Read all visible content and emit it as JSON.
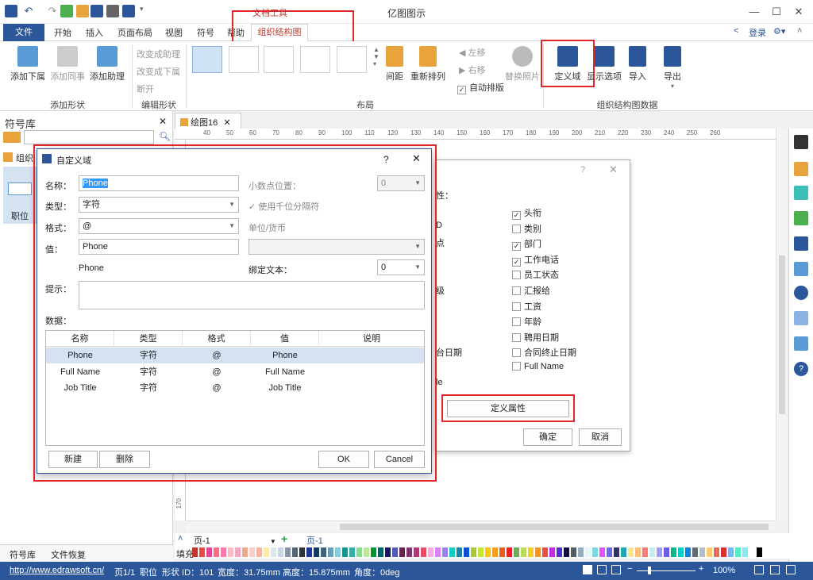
{
  "app": {
    "title": "亿图图示",
    "context_tools_label": "文档工具",
    "login": "登录"
  },
  "tabs": {
    "file": "文件",
    "home": "开始",
    "insert": "插入",
    "page_layout": "页面布局",
    "view": "视图",
    "symbol": "符号",
    "help": "帮助",
    "org_chart": "组织结构图"
  },
  "ribbon": {
    "add_shape": {
      "add_subordinate": "添加下属",
      "add_colleague": "添加同事",
      "add_assistant": "添加助理",
      "group": "添加形状"
    },
    "edit_shape": {
      "to_assistant": "改变成助理",
      "to_subordinate": "改变成下属",
      "break": "断开",
      "group": "编辑形状"
    },
    "layout": {
      "spacing": "间距",
      "rearrange": "重新排列",
      "move_left": "左移",
      "move_right": "右移",
      "auto_arrange": "自动排版",
      "replace_photo": "替换照片",
      "group": "布局"
    },
    "org_data": {
      "define_field": "定义域",
      "display_options": "显示选项",
      "import": "导入",
      "export": "导出",
      "group": "组织结构图数据"
    }
  },
  "left_panel": {
    "title": "符号库",
    "lib_item": "组织",
    "shape_label": "职位",
    "tab_library": "符号库",
    "tab_recover": "文件恢复"
  },
  "document": {
    "tab": "绘图16",
    "ruler_marks": [
      "40",
      "50",
      "60",
      "70",
      "80",
      "90",
      "100",
      "110",
      "120",
      "130",
      "140",
      "150",
      "160",
      "170",
      "180",
      "190",
      "200",
      "210",
      "220",
      "230",
      "240",
      "250",
      "260"
    ],
    "v_ruler_mark": "170"
  },
  "page_bar": {
    "page_select": "页-1",
    "page_tab": "页-1",
    "fill_label": "填充"
  },
  "status": {
    "url": "http://www.edrawsoft.cn/",
    "page": "页1/1",
    "position": "职位",
    "shape_id": "形状 ID：101",
    "width": "宽度：31.75mm",
    "height": "高度：15.875mm",
    "angle": "角度：0deg",
    "zoom": "100%"
  },
  "bg_dialog": {
    "help": "?",
    "partial_labels": [
      "性：",
      "D",
      "点",
      "级",
      "台日期",
      "le"
    ],
    "fields": [
      {
        "label": "头衔",
        "checked": true
      },
      {
        "label": "类别",
        "checked": false
      },
      {
        "label": "部门",
        "checked": true
      },
      {
        "label": "工作电话",
        "checked": true
      },
      {
        "label": "员工状态",
        "checked": false
      },
      {
        "label": "汇报给",
        "checked": false
      },
      {
        "label": "工资",
        "checked": false
      },
      {
        "label": "年龄",
        "checked": false
      },
      {
        "label": "聘用日期",
        "checked": false
      },
      {
        "label": "合同终止日期",
        "checked": false
      },
      {
        "label": "Full Name",
        "checked": false
      }
    ],
    "define_attr": "定义属性",
    "ok": "确定",
    "cancel": "取消"
  },
  "dialog": {
    "title": "自定义域",
    "help": "?",
    "name_label": "名称：",
    "name_value": "Phone",
    "type_label": "类型：",
    "type_value": "字符",
    "format_label": "格式：",
    "format_value": "@",
    "value_label": "值：",
    "value_value": "Phone",
    "preview": "Phone",
    "decimal_label": "小数点位置：",
    "decimal_value": "0",
    "thousand_sep": "使用千位分隔符",
    "unit_label": "单位/货币",
    "bind_label": "绑定文本：",
    "bind_value": "0",
    "hint_label": "提示：",
    "data_label": "数据：",
    "columns": [
      "名称",
      "类型",
      "格式",
      "值",
      "说明"
    ],
    "rows": [
      [
        "Phone",
        "字符",
        "@",
        "Phone",
        ""
      ],
      [
        "Full Name",
        "字符",
        "@",
        "Full Name",
        ""
      ],
      [
        "Job Title",
        "字符",
        "@",
        "Job Title",
        ""
      ]
    ],
    "new": "新建",
    "delete": "删除",
    "ok": "OK",
    "cancel": "Cancel"
  }
}
